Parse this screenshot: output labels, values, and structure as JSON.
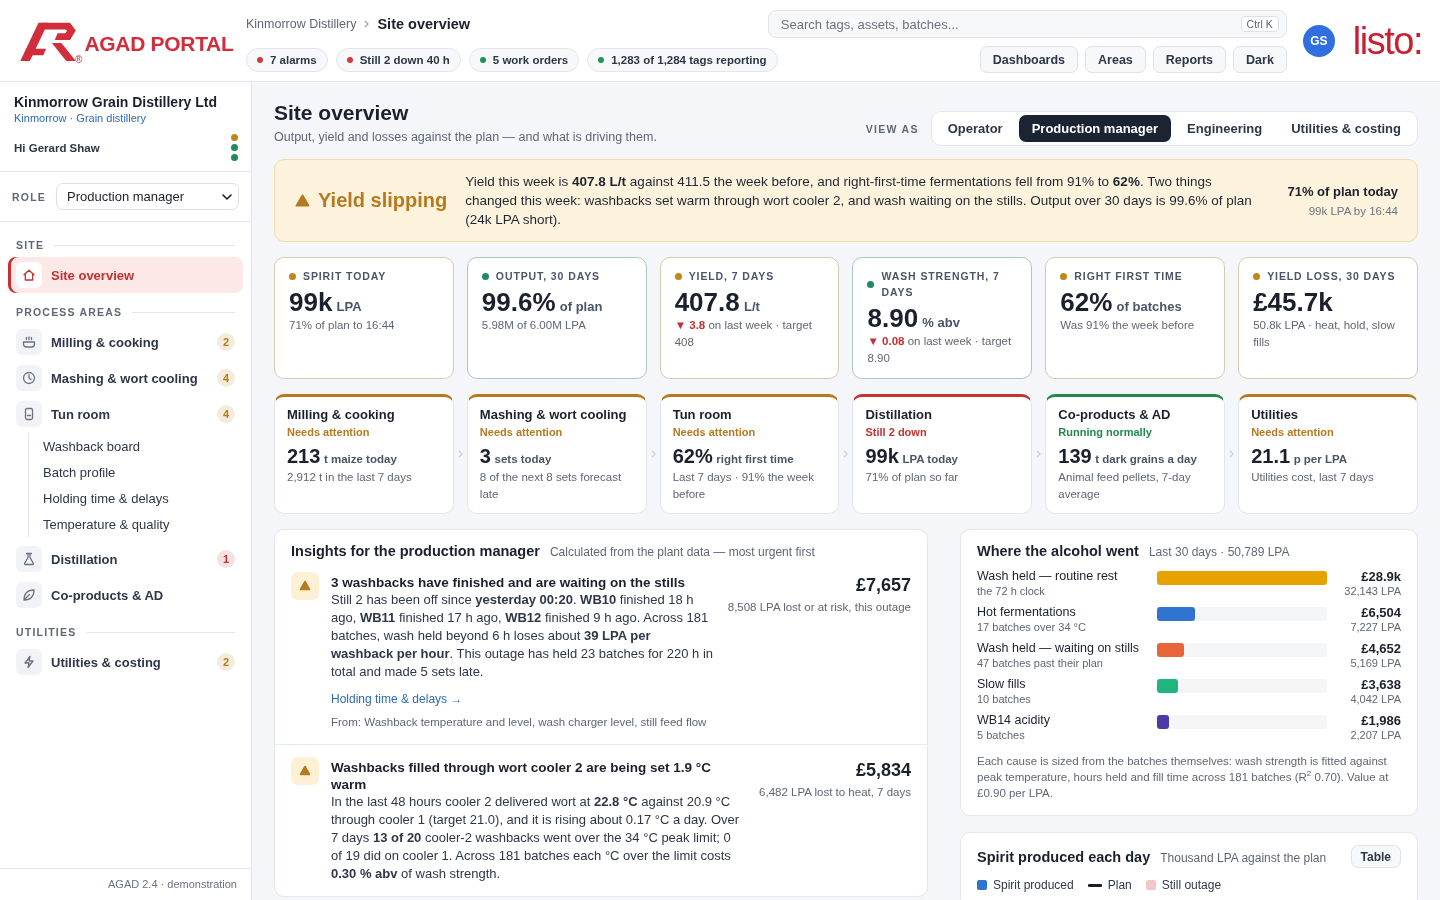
{
  "header": {
    "logo": {
      "name": "AGAD PORTAL",
      "mark": "®"
    },
    "breadcrumb": {
      "parent": "Kinmorrow Distillery",
      "current": "Site overview"
    },
    "status_pills": [
      {
        "label": "7 alarms",
        "color": "#d53a3a"
      },
      {
        "label": "Still 2 down 40 h",
        "color": "#d53a3a"
      },
      {
        "label": "5 work orders",
        "color": "#1f9254"
      },
      {
        "label": "1,283 of 1,284 tags reporting",
        "color": "#1f9254"
      }
    ],
    "search": {
      "placeholder": "Search tags, assets, batches...",
      "shortcut": "Ctrl K"
    },
    "nav_buttons": [
      {
        "label": "Dashboards"
      },
      {
        "label": "Areas"
      },
      {
        "label": "Reports"
      },
      {
        "label": "Dark"
      }
    ],
    "avatar": "GS",
    "brand": "listo:"
  },
  "sidebar": {
    "company": "Kinmorrow Grain Distillery Ltd",
    "location": "Kinmorrow · Grain distillery",
    "greeting": "Hi Gerard Shaw",
    "status_dots": [
      {
        "color": "#c0861b"
      },
      {
        "color": "#1f8a5b"
      },
      {
        "color": "#1f8a5b"
      }
    ],
    "role": {
      "label": "ROLE",
      "value": "Production manager"
    },
    "sections": [
      {
        "heading": "SITE",
        "items": [
          {
            "label": "Site overview",
            "selected": true
          }
        ]
      },
      {
        "heading": "PROCESS AREAS",
        "items": [
          {
            "label": "Milling & cooking",
            "selected": false,
            "badge": {
              "text": "2",
              "color": "#b7791f"
            }
          },
          {
            "label": "Mashing & wort cooling",
            "selected": false,
            "badge": {
              "text": "4",
              "color": "#b7791f"
            }
          },
          {
            "label": "Tun room",
            "selected": false,
            "badge": {
              "text": "4",
              "color": "#b7791f"
            },
            "children": [
              {
                "label": "Washback board",
                "selected": false
              },
              {
                "label": "Batch profile",
                "selected": false
              },
              {
                "label": "Holding time & delays",
                "selected": false
              },
              {
                "label": "Temperature & quality",
                "selected": false
              }
            ]
          },
          {
            "label": "Distillation",
            "selected": false,
            "badge": {
              "text": "1",
              "color": "#c53030"
            }
          },
          {
            "label": "Co-products & AD",
            "selected": false
          }
        ]
      },
      {
        "heading": "UTILITIES",
        "items": [
          {
            "label": "Utilities & costing",
            "selected": false,
            "badge": {
              "text": "2",
              "color": "#b7791f"
            }
          }
        ]
      }
    ],
    "footer": "AGAD 2.4 · demonstration"
  },
  "page": {
    "title": "Site overview",
    "subtitle": "Output, yield and losses against the plan — and what is driving them.",
    "view_as": {
      "label": "VIEW AS",
      "options": [
        {
          "label": "Operator",
          "selected": false
        },
        {
          "label": "Production manager",
          "selected": true
        },
        {
          "label": "Engineering",
          "selected": false
        },
        {
          "label": "Utilities & costing",
          "selected": false
        }
      ]
    }
  },
  "alert": {
    "title": "Yield slipping",
    "text": "Yield this week is **407.8 L/t** against 411.5 the week before, and right-first-time fermentations fell from 91% to **62%**. Two things changed this week: washbacks set warm through wort cooler 2, and wash waiting on the stills. Output over 30 days is 99.6% of plan (24k LPA short).",
    "summary": "71% of plan today",
    "detail": "99k LPA by 16:44"
  },
  "kpis": [
    {
      "label": "SPIRIT TODAY",
      "color": "#c0861b",
      "value": "99k",
      "unit": "LPA",
      "note": "71% of plan to 16:44"
    },
    {
      "label": "OUTPUT, 30 DAYS",
      "color": "#1f8a5b",
      "value": "99.6%",
      "unit": "of plan",
      "note": "5.98M of 6.00M LPA"
    },
    {
      "label": "YIELD, 7 DAYS",
      "color": "#c0861b",
      "value": "407.8",
      "unit": "L/t",
      "delta": "▼ 3.8",
      "note": "on last week · target 408"
    },
    {
      "label": "WASH STRENGTH, 7 DAYS",
      "color": "#1f8a5b",
      "value": "8.90",
      "unit": "% abv",
      "delta": "▼ 0.08",
      "note": "on last week · target 8.90"
    },
    {
      "label": "RIGHT FIRST TIME",
      "color": "#c0861b",
      "value": "62%",
      "unit": "of batches",
      "note": "Was 91% the week before"
    },
    {
      "label": "YIELD LOSS, 30 DAYS",
      "color": "#c0861b",
      "value": "£45.7k",
      "note": "50.8k LPA · heat, hold, slow fills"
    }
  ],
  "areas": [
    {
      "name": "Milling & cooking",
      "status": "Needs attention",
      "color": "#b7791f",
      "value": "213",
      "unit": "t maize today",
      "note": "2,912 t in the last 7 days"
    },
    {
      "name": "Mashing & wort cooling",
      "status": "Needs attention",
      "color": "#b7791f",
      "value": "3",
      "unit": "sets today",
      "note": "8 of the next 8 sets forecast late"
    },
    {
      "name": "Tun room",
      "status": "Needs attention",
      "color": "#b7791f",
      "value": "62%",
      "unit": "right first time",
      "note": "Last 7 days · 91% the week before"
    },
    {
      "name": "Distillation",
      "status": "Still 2 down",
      "color": "#c53030",
      "value": "99k",
      "unit": "LPA today",
      "note": "71% of plan so far"
    },
    {
      "name": "Co-products & AD",
      "status": "Running normally",
      "color": "#1f8a4c",
      "value": "139",
      "unit": "t dark grains a day",
      "note": "Animal feed pellets, 7-day average"
    },
    {
      "name": "Utilities",
      "status": "Needs attention",
      "color": "#b7791f",
      "value": "21.1",
      "unit": "p per LPA",
      "note": "Utilities cost, last 7 days"
    }
  ],
  "insights": {
    "title": "Insights for the production manager",
    "subtitle": "Calculated from the plant data — most urgent first",
    "items": [
      {
        "title": "3 washbacks have finished and are waiting on the stills",
        "text": "Still 2 has been off since **yesterday 00:20**. **WB10** finished 18 h ago, **WB11** finished 17 h ago, **WB12** finished 9 h ago. Across 181 batches, wash held beyond 6 h loses about **39 LPA per washback per hour**. This outage has held 23 batches for 220 h in total and made 5 sets late.",
        "link": "Holding time & delays →",
        "source": "From: Washback temperature and level, wash charger level, still feed flow",
        "amount": "£7,657",
        "amount_note": "8,508 LPA lost or at risk, this outage"
      },
      {
        "title": "Washbacks filled through wort cooler 2 are being set 1.9 °C warm",
        "text": "In the last 48 hours cooler 2 delivered wort at **22.8 °C** against 20.9 °C through cooler 1 (target 21.0), and it is rising about 0.17 °C a day. Over 7 days **13 of 20** cooler-2 washbacks went over the 34 °C peak limit; 0 of 19 did on cooler 1. Across 181 batches each °C over the limit costs **0.30 % abv** of wash strength.",
        "amount": "£5,834",
        "amount_note": "6,482 LPA lost to heat, 7 days"
      }
    ]
  },
  "alcohol": {
    "title": "Where the alcohol went",
    "subtitle": "Last 30 days · 50,789 LPA",
    "causes": [
      {
        "name": "Wash held — routine rest",
        "detail": "the 72 h clock",
        "level": 1,
        "color": "#e8a200",
        "value": "£28.9k",
        "lpa": "32,143 LPA"
      },
      {
        "name": "Hot fermentations",
        "detail": "17 batches over 34 °C",
        "level": 0.225,
        "color": "#2f74d0",
        "value": "£6,504",
        "lpa": "7,227 LPA"
      },
      {
        "name": "Wash held — waiting on stills",
        "detail": "47 batches past their plan",
        "level": 0.161,
        "color": "#e8643a",
        "value": "£4,652",
        "lpa": "5,169 LPA"
      },
      {
        "name": "Slow fills",
        "detail": "10 batches",
        "level": 0.126,
        "color": "#1fb57c",
        "value": "£3,638",
        "lpa": "4,042 LPA"
      },
      {
        "name": "WB14 acidity",
        "detail": "5 batches",
        "level": 0.069,
        "color": "#4b3aa8",
        "value": "£1,986",
        "lpa": "2,207 LPA"
      }
    ],
    "footnote": "Each cause is sized from the batches themselves: wash strength is fitted against peak temperature, hours held and fill time across 181 batches (R$^{2}$ 0.70). Value at £0.90 per LPA."
  },
  "spirit_chart": {
    "title": "Spirit produced each day",
    "subtitle": "Thousand LPA against the plan",
    "button": "Table",
    "legend": [
      {
        "label": "Spirit produced",
        "kind": "swatch",
        "color": "#2f74d0"
      },
      {
        "label": "Plan",
        "kind": "line",
        "color": "#1a202c"
      },
      {
        "label": "Still outage",
        "kind": "swatch",
        "color": "#f4c7c7"
      }
    ]
  }
}
